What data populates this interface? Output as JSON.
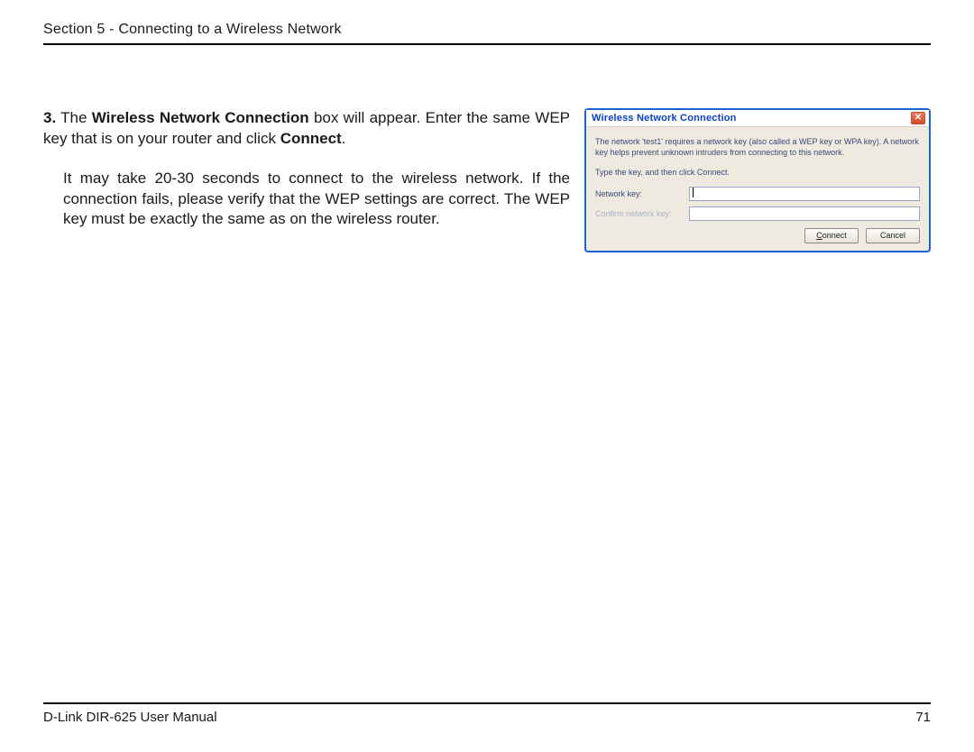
{
  "header": {
    "section": "Section 5 - Connecting to a Wireless Network"
  },
  "body": {
    "step_num": "3.",
    "step_pre": " The ",
    "step_bold1": "Wireless Network Connection",
    "step_mid": " box will appear. Enter the same WEP key that is on your router and click ",
    "step_bold2": "Connect",
    "step_post": ".",
    "para2": "It may take 20-30 seconds to connect to the wireless network. If the connection fails, please verify that the WEP settings are correct. The WEP key must be exactly the same as on the wireless router."
  },
  "dialog": {
    "title": "Wireless Network Connection",
    "close": "✕",
    "desc": "The network 'test1' requires a network key (also called a WEP key or WPA key). A network key helps prevent unknown intruders from connecting to this network.",
    "line2": "Type the key, and then click Connect.",
    "labels": {
      "key": "Network key:",
      "confirm": "Confirm network key:"
    },
    "fields": {
      "key_value": "",
      "confirm_value": ""
    },
    "buttons": {
      "connect_pre": "C",
      "connect_rest": "onnect",
      "cancel": "Cancel"
    }
  },
  "footer": {
    "manual": "D-Link DIR-625 User Manual",
    "page": "71"
  }
}
